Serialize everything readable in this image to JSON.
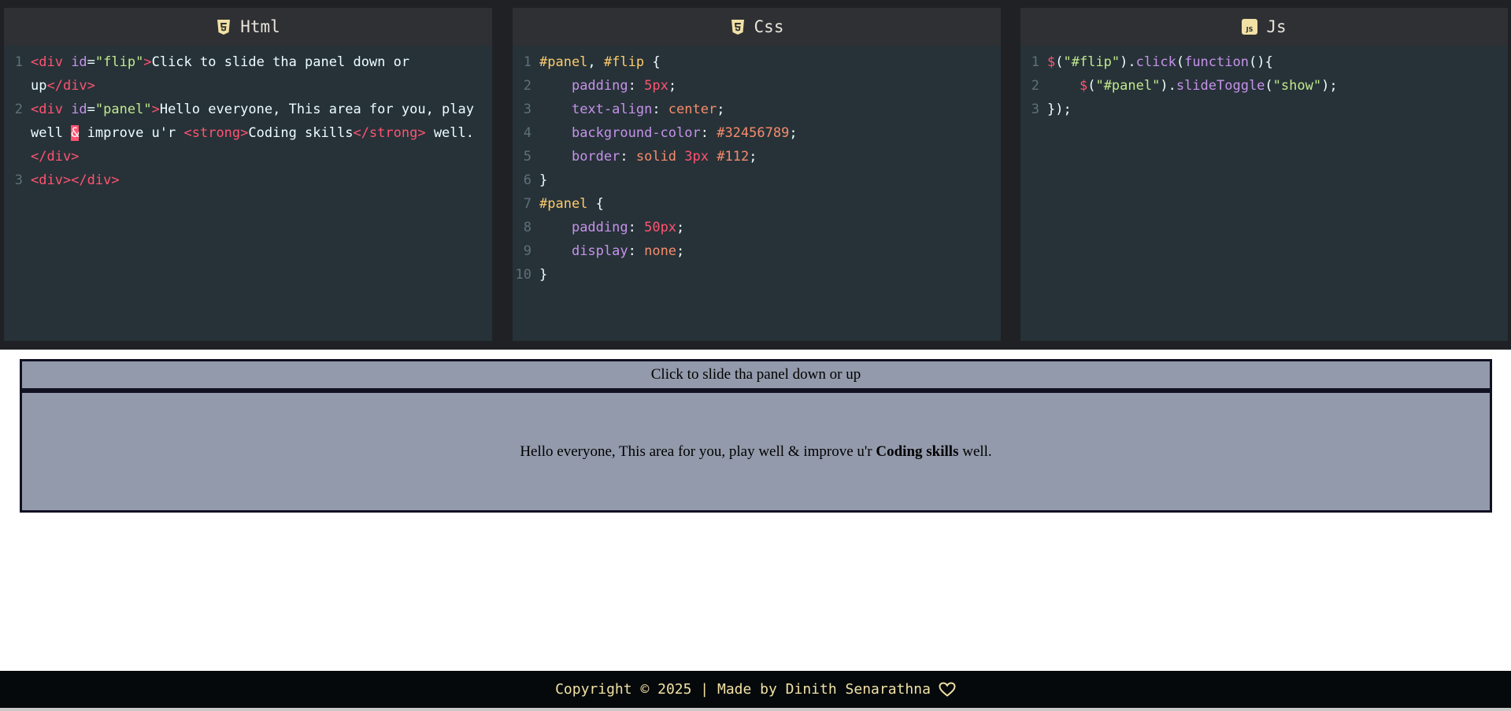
{
  "editors": [
    {
      "title": "Html",
      "icon": "html5-icon"
    },
    {
      "title": "Css",
      "icon": "css3-icon"
    },
    {
      "title": "Js",
      "icon": "js-icon"
    }
  ],
  "html_code": {
    "l1_open": "<div",
    "l1_attr": " id",
    "l1_eq": "=",
    "l1_str": "\"flip\"",
    "l1_gt": ">",
    "l1_text": "Click to slide tha panel down or up",
    "l1_close": "</div>",
    "l2_open": "<div",
    "l2_attr": " id",
    "l2_eq": "=",
    "l2_str": "\"panel\"",
    "l2_gt": ">",
    "l2_text1": "Hello everyone, This area for you, play well ",
    "l2_amp": "&",
    "l2_text2": " improve u'r ",
    "l2_strong_open": "<strong>",
    "l2_strong_text": "Coding skills",
    "l2_strong_close": "</strong>",
    "l2_text3": " well.",
    "l2_close": "</div>",
    "l3": "<div></div>"
  },
  "css_code": {
    "l1_sel1": "#panel",
    "l1_comma": ", ",
    "l1_sel2": "#flip",
    "l1_brace": " {",
    "l2_prop": "padding",
    "l2_val": "5px",
    "l3_prop": "text-align",
    "l3_val": "center",
    "l4_prop": "background-color",
    "l4_val": "#32456789",
    "l5_prop": "border",
    "l5_val1": "solid",
    "l5_val2": "3px",
    "l5_val3": "#112",
    "l6": "}",
    "l7_sel": "#panel",
    "l7_brace": " {",
    "l8_prop": "padding",
    "l8_val": "50px",
    "l9_prop": "display",
    "l9_val": "none",
    "l10": "}"
  },
  "js_code": {
    "l1_dollar": "$",
    "l1_p1": "(",
    "l1_str": "\"#flip\"",
    "l1_p2": ").",
    "l1_fn": "click",
    "l1_p3": "(",
    "l1_kw": "function",
    "l1_p4": "(){",
    "l2_dollar": "$",
    "l2_p1": "(",
    "l2_str": "\"#panel\"",
    "l2_p2": ").",
    "l2_fn": "slideToggle",
    "l2_p3": "(",
    "l2_str2": "\"show\"",
    "l2_p4": ");",
    "l3": "});"
  },
  "preview": {
    "flip_text": "Click to slide tha panel down or up",
    "panel_text_before": "Hello everyone, This area for you, play well & improve u'r ",
    "panel_strong": "Coding skills",
    "panel_text_after": " well."
  },
  "footer": {
    "text": "Copyright © 2025 | Made by Dinith Senarathna",
    "heart_icon": "heart-outline-icon"
  }
}
